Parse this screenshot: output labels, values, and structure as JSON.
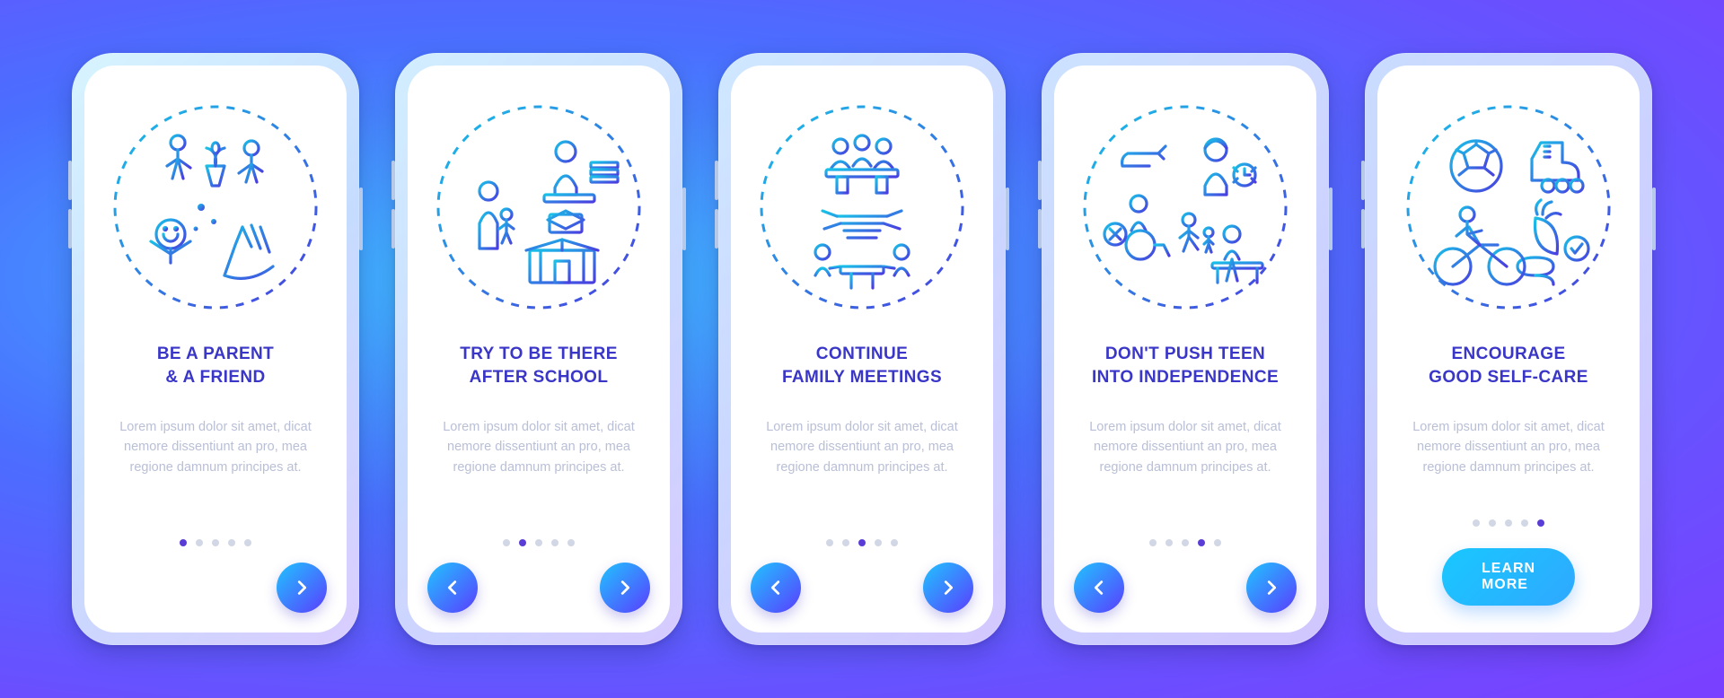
{
  "subtitle": "Lorem ipsum dolor sit amet, dicat nemore dissentiunt an pro, mea regione damnum principes at.",
  "cta_label": "LEARN MORE",
  "screens": [
    {
      "title": "BE A PARENT\n& A FRIEND",
      "active_index": 0
    },
    {
      "title": "TRY TO BE THERE\nAFTER SCHOOL",
      "active_index": 1
    },
    {
      "title": "CONTINUE\nFAMILY MEETINGS",
      "active_index": 2
    },
    {
      "title": "DON'T PUSH TEEN\nINTO INDEPENDENCE",
      "active_index": 3
    },
    {
      "title": "ENCOURAGE\nGOOD SELF-CARE",
      "active_index": 4
    }
  ],
  "icons": {
    "s1": "parent-friend-icon",
    "s2": "after-school-icon",
    "s3": "family-meetings-icon",
    "s4": "independence-icon",
    "s5": "self-care-icon"
  }
}
